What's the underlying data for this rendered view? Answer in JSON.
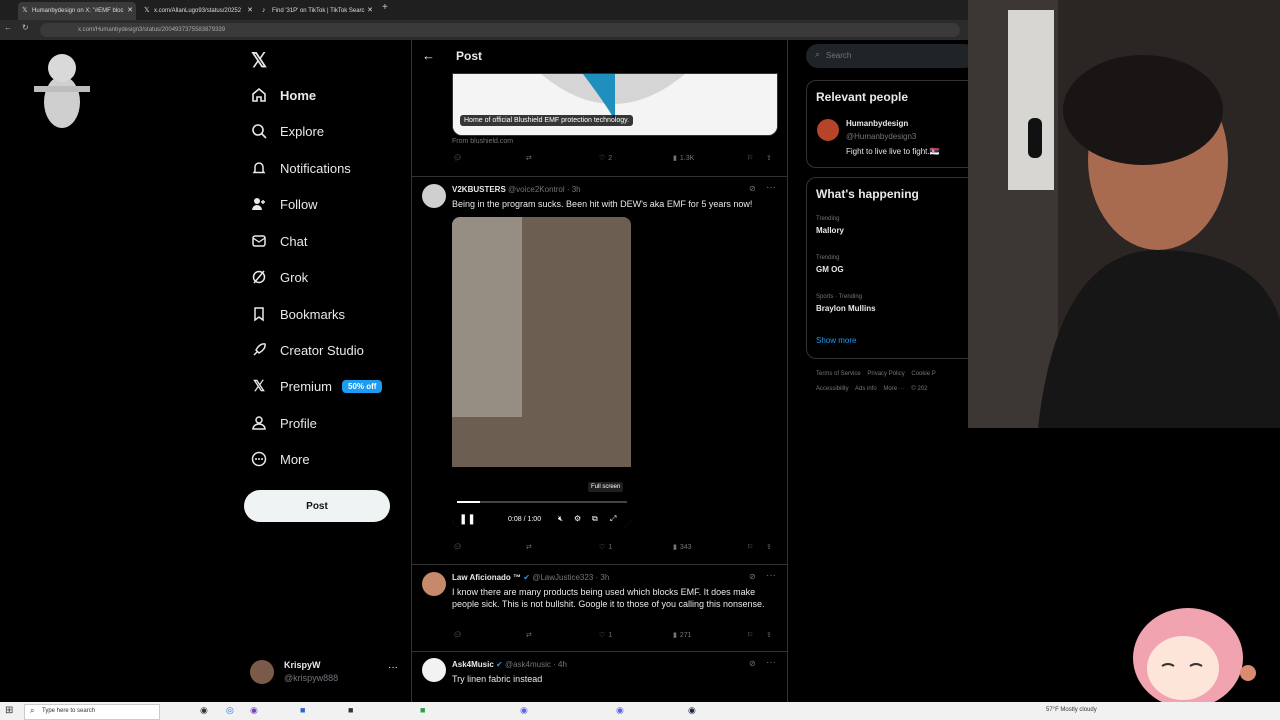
{
  "browser": {
    "tabs": [
      {
        "label": "Humanbydesign on X: \"#EMF bloc",
        "icon": "x-logo-icon"
      },
      {
        "label": "x.com/AllanLugo93/status/20252",
        "icon": "x-logo-icon"
      },
      {
        "label": "Find '31P' on TikTok | TikTok Searc",
        "icon": "tiktok-icon"
      }
    ],
    "url": "x.com/Humanbydesign3/status/2004937375583879339"
  },
  "nav": {
    "items": [
      {
        "label": "Home"
      },
      {
        "label": "Explore"
      },
      {
        "label": "Notifications"
      },
      {
        "label": "Follow"
      },
      {
        "label": "Chat"
      },
      {
        "label": "Grok"
      },
      {
        "label": "Bookmarks"
      },
      {
        "label": "Creator Studio"
      },
      {
        "label": "Premium"
      },
      {
        "label": "Profile"
      },
      {
        "label": "More"
      }
    ],
    "premium_badge": "50% off",
    "post_button": "Post",
    "account": {
      "name": "KrispyW",
      "handle": "@krispyw888",
      "more": "···"
    }
  },
  "header": {
    "title": "Post"
  },
  "card": {
    "caption": "Home of official Blushield EMF protection technology.",
    "source": "From blushield.com"
  },
  "post1_actions": {
    "likes": "2",
    "views": "1.3K"
  },
  "reply1": {
    "name": "V2KBUSTERS",
    "handle": "@voice2Kontrol · 3h",
    "text": "Being in the program sucks. Been hit with DEW's aka EMF  for 5 years now!",
    "video": {
      "time": "0:08 / 1:00",
      "tooltip": "Full screen",
      "progress": 0.133
    },
    "likes": "1",
    "views": "343"
  },
  "reply2": {
    "name": "Law Aficionado ™",
    "handle": "@LawJustice323 · 3h",
    "text": "I know there are many products being used which blocks EMF. It does make people sick. This is not bullshit. Google it to those of you calling this nonsense.",
    "likes": "1",
    "views": "271"
  },
  "reply3": {
    "name": "Ask4Music",
    "handle": "@ask4music · 4h",
    "text": "Try linen fabric instead"
  },
  "right": {
    "search_placeholder": "Search",
    "relevant_title": "Relevant people",
    "person": {
      "name": "Humanbydesign",
      "handle": "@Humanbydesign3",
      "bio": "Fight to live live to fight.🇷🇸"
    },
    "happening_title": "What's happening",
    "trends": [
      {
        "context": "Trending",
        "name": "Mallory"
      },
      {
        "context": "Trending",
        "name": "GM OG"
      },
      {
        "context": "Sports · Trending",
        "name": "Braylon Mullins"
      }
    ],
    "show_more": "Show more",
    "footer1": [
      "Terms of Service",
      "Privacy Policy",
      "Cookie P"
    ],
    "footer2": [
      "Accessibility",
      "Ads info",
      "More ···",
      "© 202"
    ]
  },
  "taskbar": {
    "search_placeholder": "Type here to search",
    "weather": "57°F  Mostly cloudy"
  },
  "colors": {
    "accent": "#1d9bf0",
    "bg": "#000000",
    "border": "#2f3336",
    "muted": "#71767b"
  }
}
